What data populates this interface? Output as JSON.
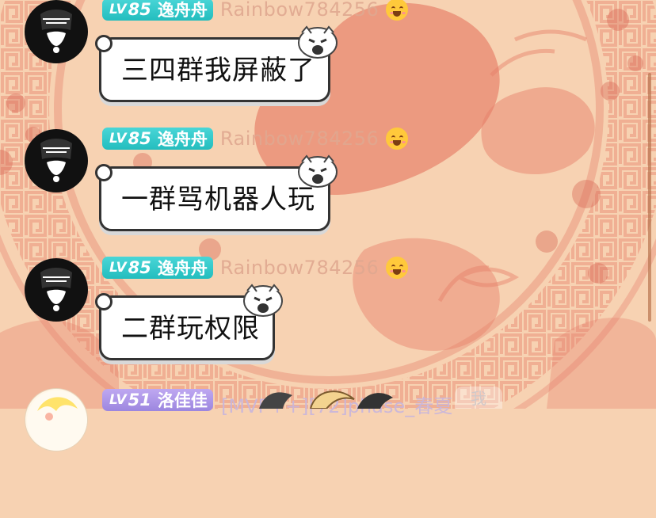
{
  "messages": [
    {
      "level_prefix": "LV",
      "level": "85",
      "badge_name": "逸舟舟",
      "username": "Rainbow784256",
      "text": "三四群我屏蔽了"
    },
    {
      "level_prefix": "LV",
      "level": "85",
      "badge_name": "逸舟舟",
      "username": "Rainbow784256",
      "text": "一群骂机器人玩"
    },
    {
      "level_prefix": "LV",
      "level": "85",
      "badge_name": "逸舟舟",
      "username": "Rainbow784256",
      "text": "二群玩权限"
    },
    {
      "level_prefix": "LV",
      "level": "51",
      "badge_name": "洛佳佳",
      "username": "[MVP++][72]phase_春夏"
    }
  ],
  "overlay_text": "我",
  "colors": {
    "background": "#f7d2b2",
    "pattern": "#e67f69",
    "teal_badge": "#2fc8c9",
    "purple_badge": "#aa96e6"
  },
  "icons": [
    "avatar-black-mask-icon",
    "avatar-cartoon-icon",
    "blushing-emoji-icon",
    "bubble-cat-deco-icon"
  ]
}
